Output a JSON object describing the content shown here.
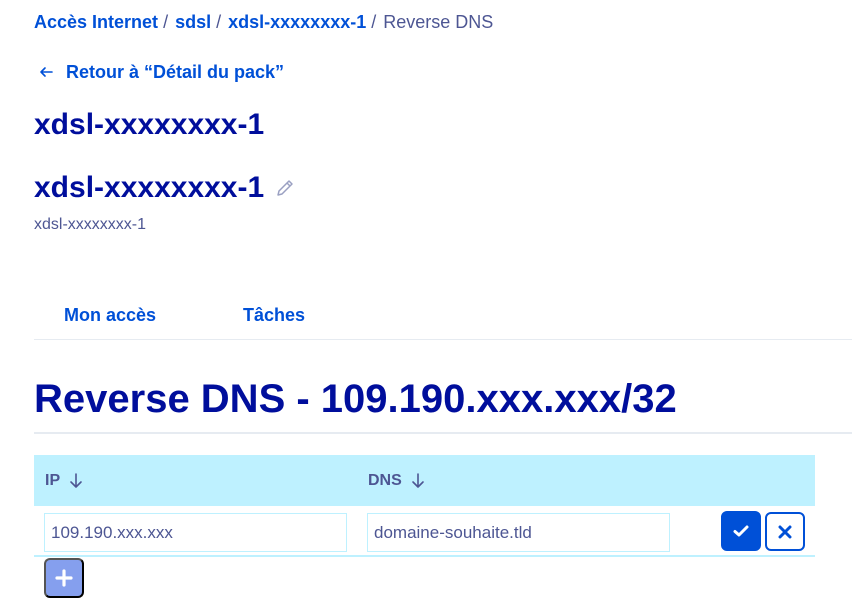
{
  "breadcrumb": {
    "items": [
      "Accès Internet",
      "sdsl",
      "xdsl-xxxxxxxx-1"
    ],
    "separator": "/",
    "current": "Reverse DNS"
  },
  "back_link": {
    "label": "Retour à “Détail du pack”",
    "icon": "arrow-left-icon"
  },
  "page_title": "xdsl-xxxxxxxx-1",
  "service": {
    "title": "xdsl-xxxxxxxx-1",
    "subtitle": "xdsl-xxxxxxxx-1",
    "edit_icon": "pencil-icon"
  },
  "tabs": [
    {
      "label": "Mon accès"
    },
    {
      "label": "Tâches"
    }
  ],
  "section_title": "Reverse DNS - 109.190.xxx.xxx/32",
  "table": {
    "columns": [
      {
        "label": "IP",
        "sort_icon": "arrow-down-icon"
      },
      {
        "label": "DNS",
        "sort_icon": "arrow-down-icon"
      }
    ],
    "rows": [
      {
        "ip": "109.190.xxx.xxx",
        "dns": "domaine-souhaite.tld"
      }
    ],
    "confirm_icon": "check-icon",
    "cancel_icon": "close-icon",
    "add_icon": "plus-icon"
  },
  "colors": {
    "link": "#0050d7",
    "title": "#000e9c",
    "muted": "#4d5693",
    "header_bg": "#bef1ff",
    "add_button": "#859fee"
  }
}
